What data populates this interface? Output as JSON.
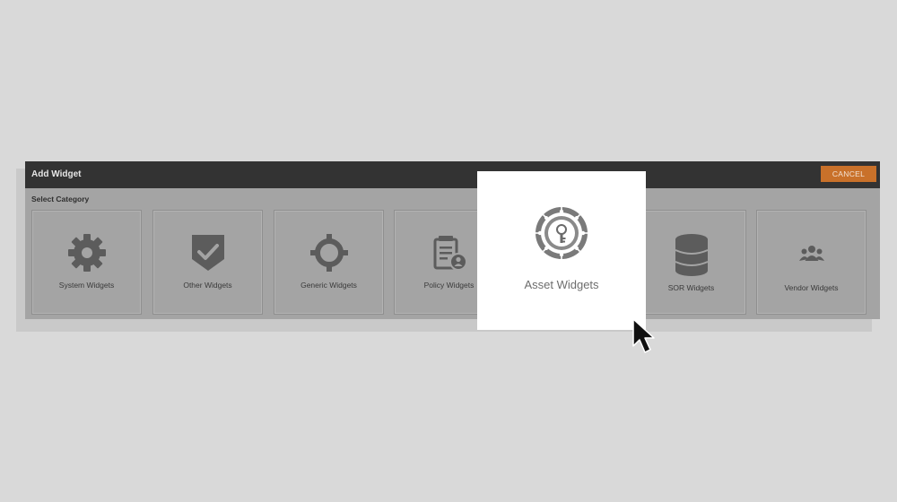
{
  "dialog": {
    "title": "Add Widget",
    "cancel_label": "CANCEL",
    "section_label": "Select Category"
  },
  "categories": [
    {
      "label": "System Widgets",
      "icon": "gear-icon"
    },
    {
      "label": "Other Widgets",
      "icon": "shield-check-icon"
    },
    {
      "label": "Generic Widgets",
      "icon": "crosshair-icon"
    },
    {
      "label": "Policy Widgets",
      "icon": "policy-document-icon"
    },
    {
      "label": "Asset Widgets",
      "icon": "asset-wheel-icon",
      "highlighted": true
    },
    {
      "label": "SOR Widgets",
      "icon": "database-icon"
    },
    {
      "label": "Vendor Widgets",
      "icon": "users-group-icon"
    }
  ],
  "colors": {
    "titlebar": "#333333",
    "accent": "#c9712a",
    "panel": "#a4a4a4",
    "icon": "#5c5c5c"
  }
}
